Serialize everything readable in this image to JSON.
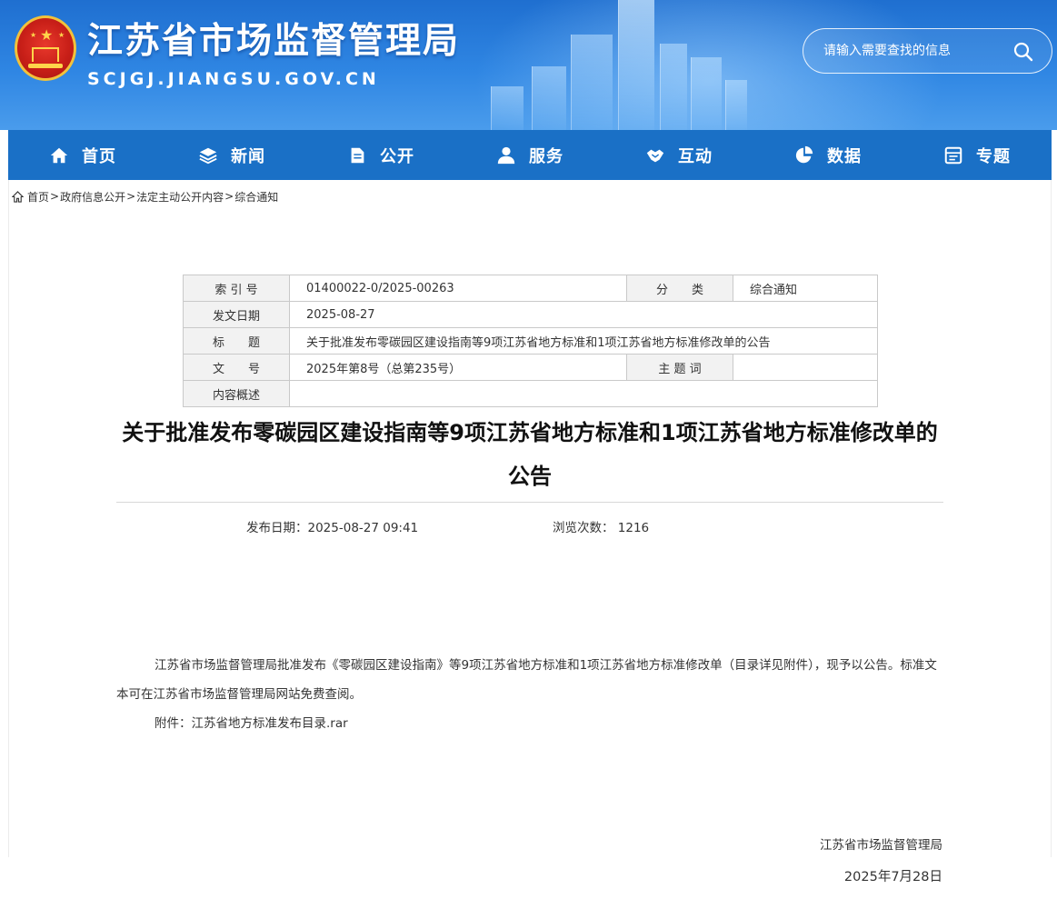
{
  "header": {
    "site_title": "江苏省市场监督管理局",
    "site_domain": "SCJGJ.JIANGSU.GOV.CN",
    "search_placeholder": "请输入需要查找的信息"
  },
  "nav": [
    {
      "label": "首页",
      "icon": "home-icon"
    },
    {
      "label": "新闻",
      "icon": "layers-icon"
    },
    {
      "label": "公开",
      "icon": "document-icon"
    },
    {
      "label": "服务",
      "icon": "user-icon"
    },
    {
      "label": "互动",
      "icon": "handshake-icon"
    },
    {
      "label": "数据",
      "icon": "pie-chart-icon"
    },
    {
      "label": "专题",
      "icon": "window-icon"
    }
  ],
  "breadcrumb": {
    "icon": "home-icon",
    "items": [
      "首页",
      "政府信息公开",
      "法定主动公开内容",
      "综合通知"
    ],
    "separator": ">"
  },
  "meta": {
    "index_label": "索 引 号",
    "index_value": "01400022-0/2025-00263",
    "category_label": "分　　类",
    "category_value": "综合通知",
    "date_label": "发文日期",
    "date_value": "2025-08-27",
    "title_label": "标　　题",
    "title_value": "关于批准发布零碳园区建设指南等9项江苏省地方标准和1项江苏省地方标准修改单的公告",
    "docno_label": "文　　号",
    "docno_value": "2025年第8号（总第235号）",
    "keyword_label": "主 题 词",
    "keyword_value": "",
    "summary_label": "内容概述",
    "summary_value": ""
  },
  "article": {
    "title": "关于批准发布零碳园区建设指南等9项江苏省地方标准和1项江苏省地方标准修改单的公告",
    "publish_date": "发布日期：2025-08-27 09:41",
    "views": "浏览次数：  1216",
    "body": "江苏省市场监督管理局批准发布《零碳园区建设指南》等9项江苏省地方标准和1项江苏省地方标准修改单（目录详见附件），现予以公告。标准文本可在江苏省市场监督管理局网站免费查阅。",
    "attachment_label": "附件：",
    "attachment_link": "江苏省地方标准发布目录.rar",
    "signature_org": "江苏省市场监督管理局",
    "signature_date": "2025年7月28日"
  },
  "colors": {
    "header_blue": "#2f86e3",
    "nav_blue": "#1a70c6",
    "emblem_red": "#c81f18",
    "emblem_gold": "#f2c23a"
  }
}
